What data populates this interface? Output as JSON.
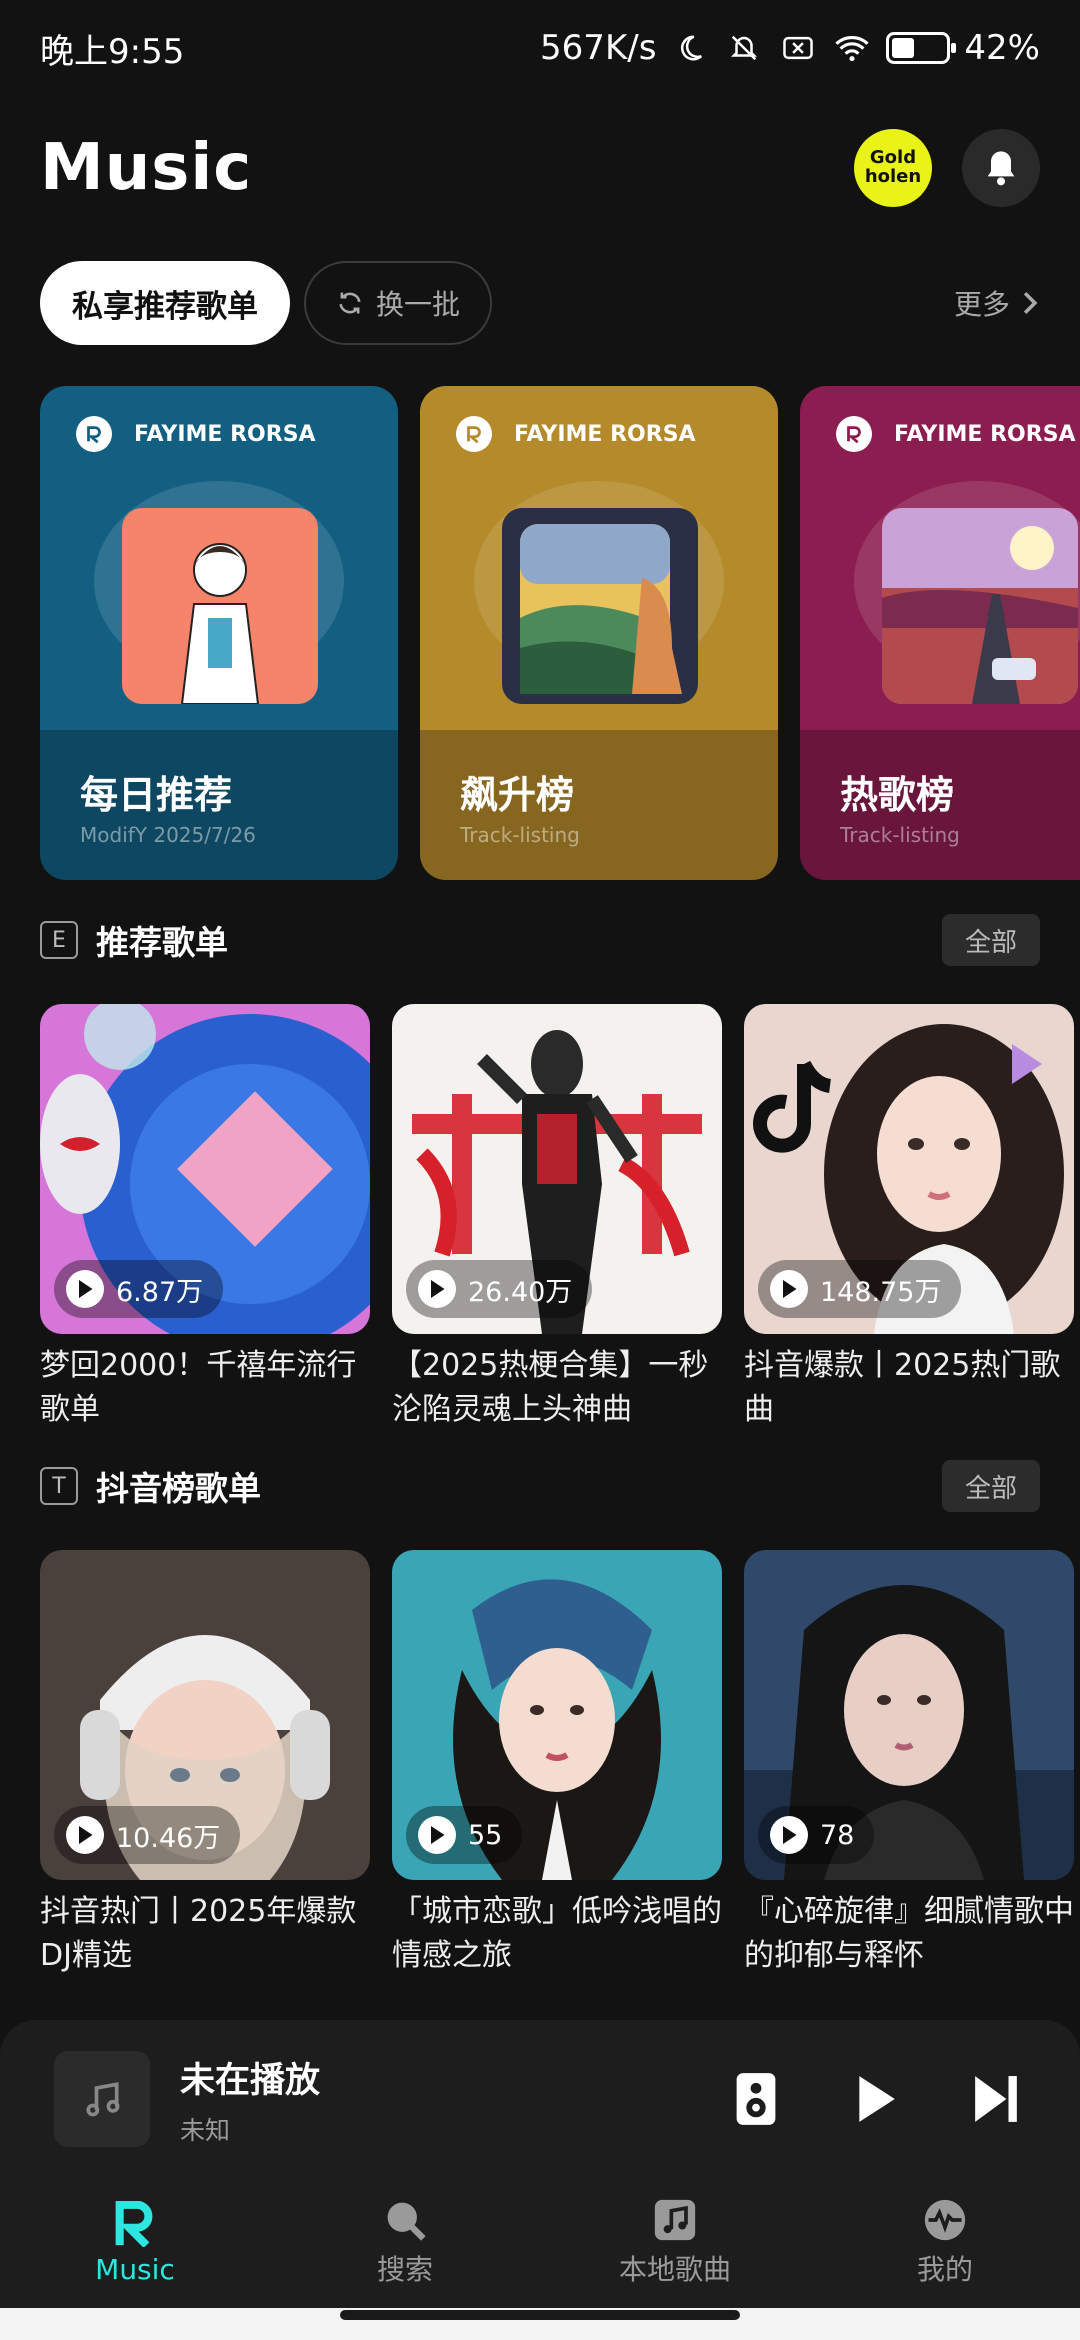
{
  "status_bar": {
    "time": "晚上9:55",
    "network_speed": "567K/s",
    "battery": "42%",
    "battery_level": 0.42,
    "icons": [
      "moon-icon",
      "mute-icon",
      "no-sim-icon",
      "wifi-icon",
      "battery-icon"
    ]
  },
  "header": {
    "title": "Music",
    "badge_line1": "Gold",
    "badge_line2": "holen",
    "bell_icon": "bell-icon"
  },
  "tabs": {
    "primary": "私享推荐歌单",
    "refresh": "换一批",
    "more": "更多"
  },
  "featured": [
    {
      "brand": "FAYIME RORSA",
      "title": "每日推荐",
      "subtitle": "ModifY   2025/7/26",
      "color": "#135f82"
    },
    {
      "brand": "FAYIME RORSA",
      "title": "飙升榜",
      "subtitle": "Track-listing",
      "color": "#b48a2a"
    },
    {
      "brand": "FAYIME RORSA",
      "title": "热歌榜",
      "subtitle": "Track-listing",
      "color": "#8c1d50"
    }
  ],
  "section1": {
    "letter": "E",
    "title": "推荐歌单",
    "all": "全部",
    "items": [
      {
        "plays": "6.87万",
        "name": "梦回2000！千禧年流行歌单"
      },
      {
        "plays": "26.40万",
        "name": "【2025热梗合集】一秒沦陷灵魂上头神曲"
      },
      {
        "plays": "148.75万",
        "name": "抖音爆款丨2025热门歌曲"
      }
    ]
  },
  "section2": {
    "letter": "T",
    "title": "抖音榜歌单",
    "all": "全部",
    "items": [
      {
        "plays": "10.46万",
        "name": "抖音热门丨2025年爆款DJ精选"
      },
      {
        "plays": "55",
        "name": "「城市恋歌」低吟浅唱的情感之旅"
      },
      {
        "plays": "78",
        "name": "『心碎旋律』细腻情歌中的抑郁与释怀"
      }
    ]
  },
  "player": {
    "title": "未在播放",
    "subtitle": "未知"
  },
  "nav": {
    "items": [
      {
        "label": "Music",
        "icon": "r-logo-icon"
      },
      {
        "label": "搜索",
        "icon": "search-icon"
      },
      {
        "label": "本地歌曲",
        "icon": "music-note-icon"
      },
      {
        "label": "我的",
        "icon": "pulse-icon"
      }
    ],
    "accent": "#2ee6e0"
  }
}
